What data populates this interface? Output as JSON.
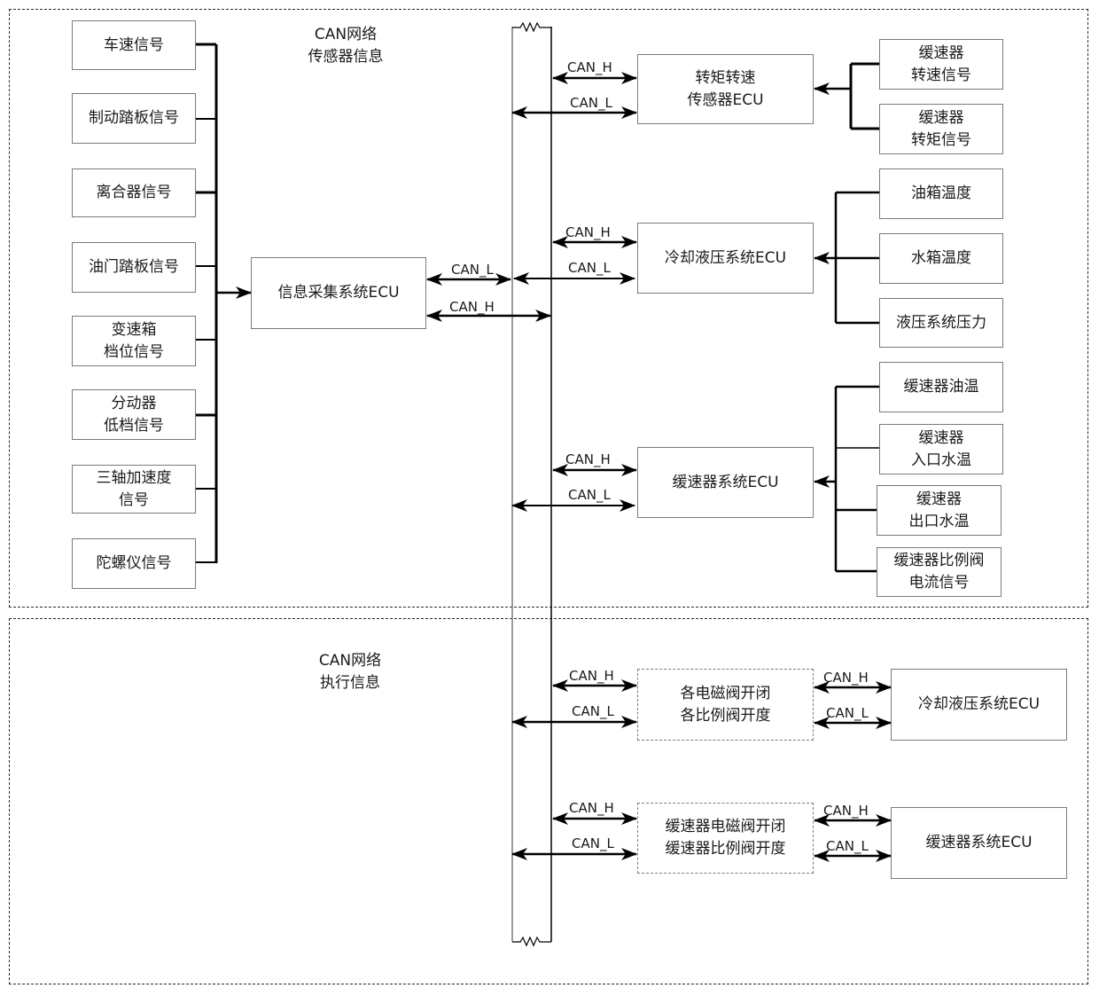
{
  "sensor_section": {
    "title": "CAN网络\n传感器信息",
    "inputs": [
      "车速信号",
      "制动踏板信号",
      "离合器信号",
      "油门踏板信号",
      "变速箱\n档位信号",
      "分动器\n低档信号",
      "三轴加速度\n信号",
      "陀螺仪信号"
    ],
    "collector_ecu": "信息采集系统ECU",
    "collector_links": [
      "CAN_L",
      "CAN_H"
    ],
    "ecus": [
      {
        "name": "转矩转速\n传感器ECU",
        "links": [
          "CAN_H",
          "CAN_L"
        ],
        "signals": [
          "缓速器\n转速信号",
          "缓速器\n转矩信号"
        ]
      },
      {
        "name": "冷却液压系统ECU",
        "links": [
          "CAN_H",
          "CAN_L"
        ],
        "signals": [
          "油箱温度",
          "水箱温度",
          "液压系统压力"
        ]
      },
      {
        "name": "缓速器系统ECU",
        "links": [
          "CAN_H",
          "CAN_L"
        ],
        "signals": [
          "缓速器油温",
          "缓速器\n入口水温",
          "缓速器\n出口水温",
          "缓速器比例阀\n电流信号"
        ]
      }
    ]
  },
  "actuator_section": {
    "title": "CAN网络\n执行信息",
    "rows": [
      {
        "command": "各电磁阀开闭\n各比例阀开度",
        "links_left": [
          "CAN_H",
          "CAN_L"
        ],
        "links_right": [
          "CAN_H",
          "CAN_L"
        ],
        "ecu": "冷却液压系统ECU"
      },
      {
        "command": "缓速器电磁阀开闭\n缓速器比例阀开度",
        "links_left": [
          "CAN_H",
          "CAN_L"
        ],
        "links_right": [
          "CAN_H",
          "CAN_L"
        ],
        "ecu": "缓速器系统ECU"
      }
    ]
  }
}
